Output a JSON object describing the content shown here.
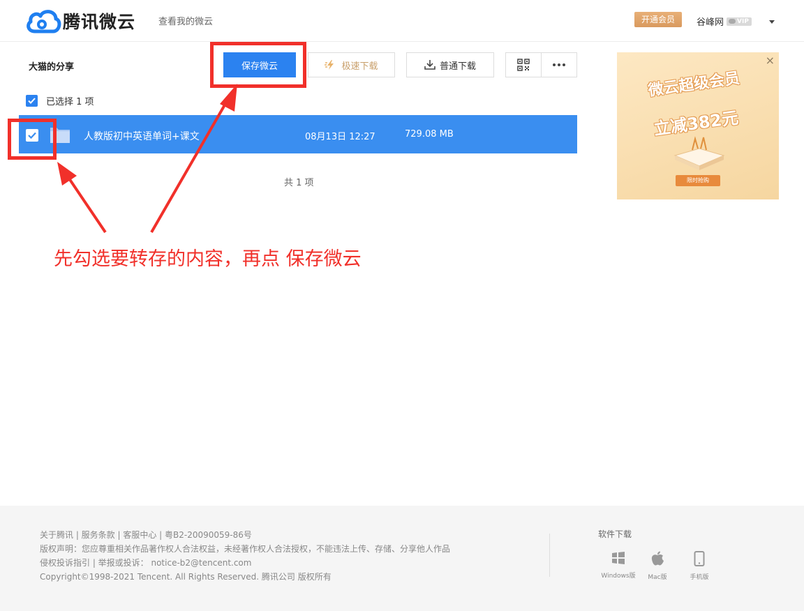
{
  "header": {
    "brand": "腾讯微云",
    "nav_link": "查看我的微云",
    "vip_button": "开通会员",
    "username": "谷峰网",
    "vip_badge": "VIP"
  },
  "share": {
    "title": "大猫的分享",
    "buttons": {
      "save": "保存微云",
      "fast_download": "极速下载",
      "normal_download": "普通下载"
    },
    "selection_text": "已选择 1 项",
    "files": [
      {
        "name": "人教版初中英语单词+课文",
        "date": "08月13日 12:27",
        "size": "729.08 MB",
        "selected": true
      }
    ],
    "total_text": "共 1 项"
  },
  "annotation": {
    "text": "先勾选要转存的内容，再点 保存微云",
    "color": "#f1302a"
  },
  "ad": {
    "title": "微云超级会员",
    "subtitle": "立减382元",
    "button": "限时抢购",
    "close": "×"
  },
  "footer": {
    "lines": [
      "关于腾讯 | 服务条款 | 客服中心 | 粤B2-20090059-86号",
      "版权声明：您应尊重相关作品著作权人合法权益，未经著作权人合法授权，不能违法上传、存储、分享他人作品",
      "侵权投诉指引 | 举报或投诉： notice-b2@tencent.com",
      "Copyright©1998-2021 Tencent. All Rights Reserved. 腾讯公司 版权所有"
    ],
    "download_title": "软件下载",
    "downloads": [
      "Windows版",
      "Mac版",
      "手机版"
    ]
  },
  "colors": {
    "primary": "#2b82f0",
    "row_selected": "#3a8ef0",
    "vip": "#d99a5e",
    "annotation_red": "#f1302a"
  }
}
